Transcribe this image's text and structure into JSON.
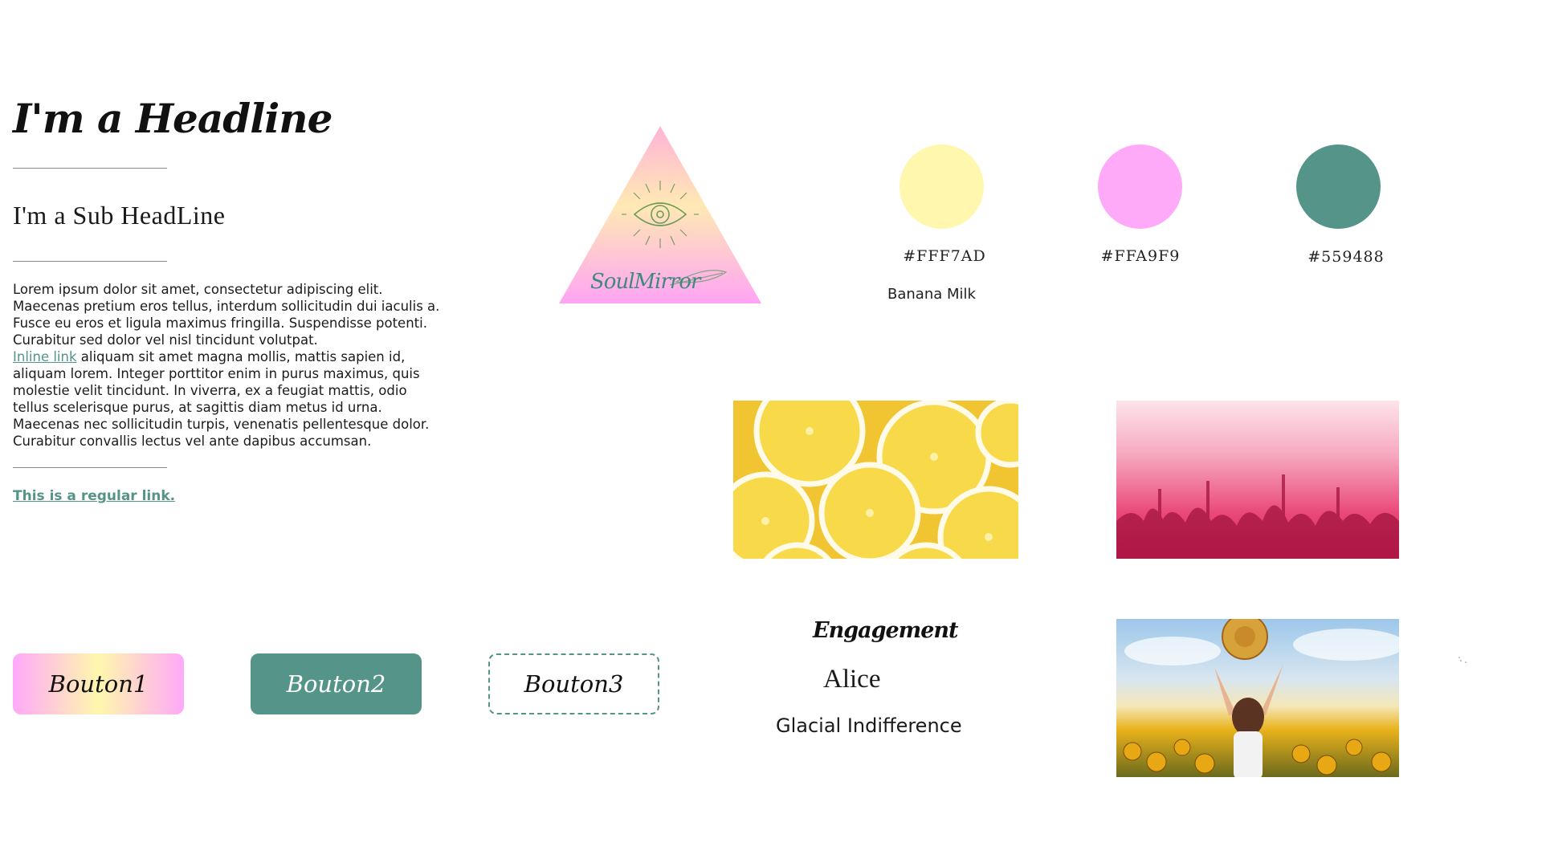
{
  "typography": {
    "headline": "I'm a Headline",
    "subheadline": "I'm a Sub HeadLine",
    "paragraph_1": "Lorem ipsum dolor sit amet, consectetur adipiscing elit. Maecenas pretium eros tellus, interdum sollicitudin dui iaculis a. Fusce eu eros et ligula maximus fringilla. Suspendisse potenti. Curabitur sed dolor vel nisl tincidunt volutpat.",
    "inline_link": "Inline link",
    "paragraph_2": " aliquam sit amet magna mollis, mattis sapien id, aliquam lorem. Integer porttitor enim in purus maximus, quis molestie velit tincidunt. In viverra, ex a feugiat mattis, odio tellus scelerisque purus, at sagittis diam metus id urna. Maecenas nec sollicitudin turpis, venenatis pellentesque dolor. Curabitur convallis lectus vel ante dapibus accumsan.",
    "regular_link": "This is a regular link."
  },
  "buttons": {
    "button1": "Bouton1",
    "button2": "Bouton2",
    "button3": "Bouton3"
  },
  "logo": {
    "wordmark": "SoulMirror",
    "icon": "eye-icon",
    "feather_icon": "feather-icon"
  },
  "palette": {
    "swatches": [
      {
        "hex": "#FFF7AD",
        "color": "#fff7ad"
      },
      {
        "hex": "#FFA9F9",
        "color": "#ffa9f9"
      },
      {
        "hex": "#559488",
        "color": "#559488"
      }
    ],
    "first_name": "Banana Milk"
  },
  "fonts": {
    "script_name": "Engagement",
    "serif_name": "Alice",
    "sans_name": "Glacial Indifference"
  },
  "images": {
    "lemons": "lemon-slices-photo",
    "crowd": "pink-festival-crowd-photo",
    "field": "sunflower-field-photo"
  }
}
